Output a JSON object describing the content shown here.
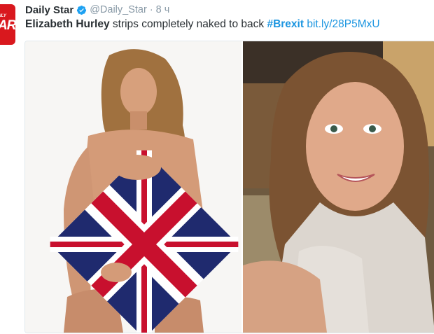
{
  "account": {
    "display_name": "Daily Star",
    "handle": "@Daily_Star",
    "separator": "·",
    "timestamp": "8 ч",
    "avatar_text_small": "ILY",
    "avatar_text_big": "AR",
    "verified": true
  },
  "tweet": {
    "text_bold": "Elizabeth Hurley",
    "text_plain": " strips completely naked to back ",
    "hashtag": "#Brexit",
    "link": "bit.ly/28P5MxU"
  },
  "media": {
    "images": [
      {
        "subject": "woman holding union jack cushion"
      },
      {
        "subject": "woman selfie in lace dress"
      }
    ]
  },
  "colors": {
    "link": "#1b95e0",
    "text": "#292f33",
    "muted": "#8899a6",
    "brand_red": "#d9181e"
  }
}
